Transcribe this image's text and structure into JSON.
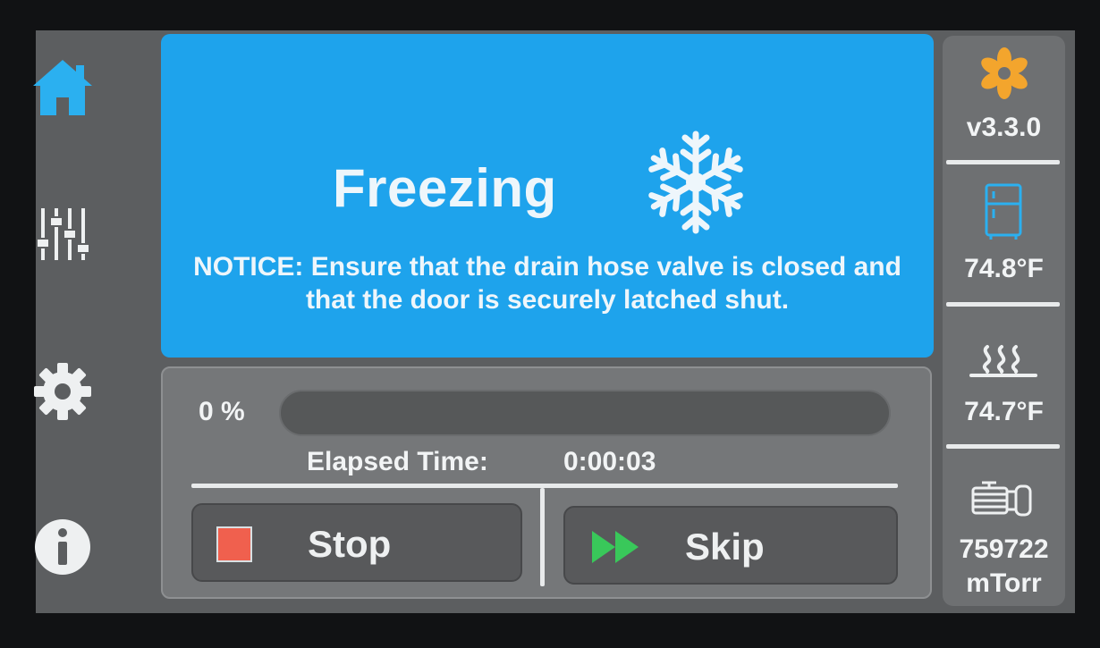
{
  "nav": {
    "items": [
      {
        "name": "home",
        "active": true
      },
      {
        "name": "sliders",
        "active": false
      },
      {
        "name": "settings",
        "active": false
      },
      {
        "name": "info",
        "active": false
      }
    ]
  },
  "status": {
    "title": "Freezing",
    "icon": "snowflake-icon",
    "notice": "NOTICE: Ensure that the drain hose valve is closed and that the door is securely latched shut."
  },
  "progress": {
    "label": "0 %",
    "value": 0
  },
  "elapsed": {
    "label": "Elapsed Time:",
    "value": "0:00:03"
  },
  "actions": {
    "stop_label": "Stop",
    "skip_label": "Skip"
  },
  "sidebar": {
    "version": "v3.3.0",
    "freezer_temp": "74.8°F",
    "heater_temp": "74.7°F",
    "vacuum_value": "759722",
    "vacuum_unit": "mTorr"
  },
  "colors": {
    "accent": "#1ea3ec",
    "stop": "#f0604e",
    "skip": "#39c85a",
    "fan": "#f3a52d"
  }
}
